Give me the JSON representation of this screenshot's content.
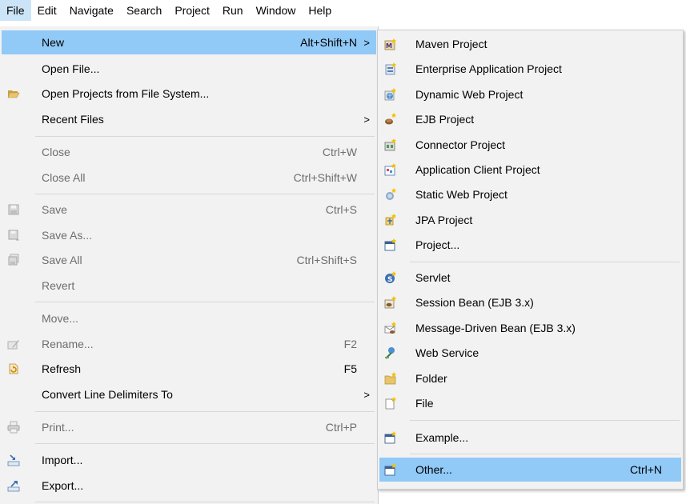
{
  "menubar": {
    "items": [
      {
        "label": "File",
        "active": true
      },
      {
        "label": "Edit"
      },
      {
        "label": "Navigate"
      },
      {
        "label": "Search"
      },
      {
        "label": "Project"
      },
      {
        "label": "Run"
      },
      {
        "label": "Window"
      },
      {
        "label": "Help"
      }
    ]
  },
  "file_menu": {
    "items": [
      {
        "label": "New",
        "shortcut": "Alt+Shift+N",
        "arrow": ">",
        "highlighted": true
      },
      {
        "label": "Open File..."
      },
      {
        "label": "Open Projects from File System...",
        "icon": "folder-open-icon"
      },
      {
        "label": "Recent Files",
        "arrow": ">"
      },
      {
        "label": "Close",
        "shortcut": "Ctrl+W",
        "disabled": true
      },
      {
        "label": "Close All",
        "shortcut": "Ctrl+Shift+W",
        "disabled": true
      },
      {
        "label": "Save",
        "shortcut": "Ctrl+S",
        "disabled": true,
        "icon": "save-icon"
      },
      {
        "label": "Save As...",
        "disabled": true,
        "icon": "save-as-icon"
      },
      {
        "label": "Save All",
        "shortcut": "Ctrl+Shift+S",
        "disabled": true,
        "icon": "save-all-icon"
      },
      {
        "label": "Revert",
        "disabled": true
      },
      {
        "label": "Move...",
        "disabled": true
      },
      {
        "label": "Rename...",
        "shortcut": "F2",
        "disabled": true,
        "icon": "rename-icon"
      },
      {
        "label": "Refresh",
        "shortcut": "F5",
        "icon": "refresh-icon"
      },
      {
        "label": "Convert Line Delimiters To",
        "arrow": ">"
      },
      {
        "label": "Print...",
        "shortcut": "Ctrl+P",
        "disabled": true,
        "icon": "print-icon"
      },
      {
        "label": "Import...",
        "icon": "import-icon"
      },
      {
        "label": "Export...",
        "icon": "export-icon"
      }
    ]
  },
  "new_submenu": {
    "items": [
      {
        "label": "Maven Project",
        "icon": "maven-project-icon"
      },
      {
        "label": "Enterprise Application Project",
        "icon": "enterprise-application-project-icon"
      },
      {
        "label": "Dynamic Web Project",
        "icon": "dynamic-web-project-icon"
      },
      {
        "label": "EJB Project",
        "icon": "ejb-project-icon"
      },
      {
        "label": "Connector Project",
        "icon": "connector-project-icon"
      },
      {
        "label": "Application Client Project",
        "icon": "application-client-project-icon"
      },
      {
        "label": "Static Web Project",
        "icon": "static-web-project-icon"
      },
      {
        "label": "JPA Project",
        "icon": "jpa-project-icon"
      },
      {
        "label": "Project...",
        "icon": "project-icon"
      },
      {
        "label": "Servlet",
        "icon": "servlet-icon"
      },
      {
        "label": "Session Bean (EJB 3.x)",
        "icon": "session-bean-icon"
      },
      {
        "label": "Message-Driven Bean (EJB 3.x)",
        "icon": "message-driven-bean-icon"
      },
      {
        "label": "Web Service",
        "icon": "web-service-icon"
      },
      {
        "label": "Folder",
        "icon": "folder-icon"
      },
      {
        "label": "File",
        "icon": "file-icon"
      },
      {
        "label": "Example...",
        "icon": "example-icon"
      },
      {
        "label": "Other...",
        "shortcut": "Ctrl+N",
        "icon": "other-wizard-icon",
        "highlighted": true
      }
    ]
  },
  "colors": {
    "menu_background": "#f2f2f2",
    "highlight": "#91c9f7",
    "menubar_active": "#cce4f7",
    "disabled_text": "#6d6d6d"
  }
}
